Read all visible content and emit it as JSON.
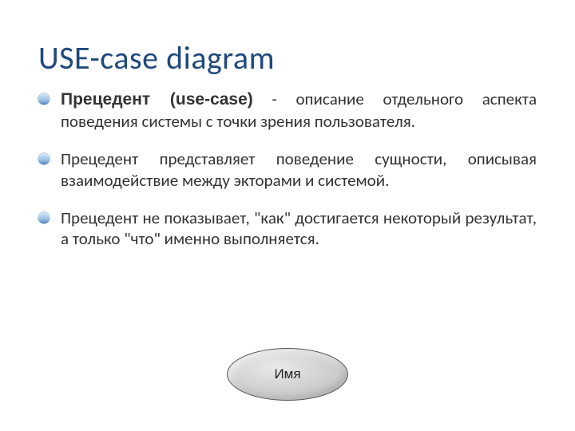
{
  "title": "USE-case diagram",
  "bullets": [
    {
      "lead": "Прецедент (use-case)",
      "rest": " - описание отдельного аспекта поведения системы с точки зрения пользователя."
    },
    {
      "text": "Прецедент представляет поведение сущности, описывая взаимодействие между экторами и системой."
    },
    {
      "text": "Прецедент не показывает, \"как\" достигается некоторый результат, а только \"что\" именно выполняется."
    }
  ],
  "figure": {
    "label": "Имя"
  }
}
